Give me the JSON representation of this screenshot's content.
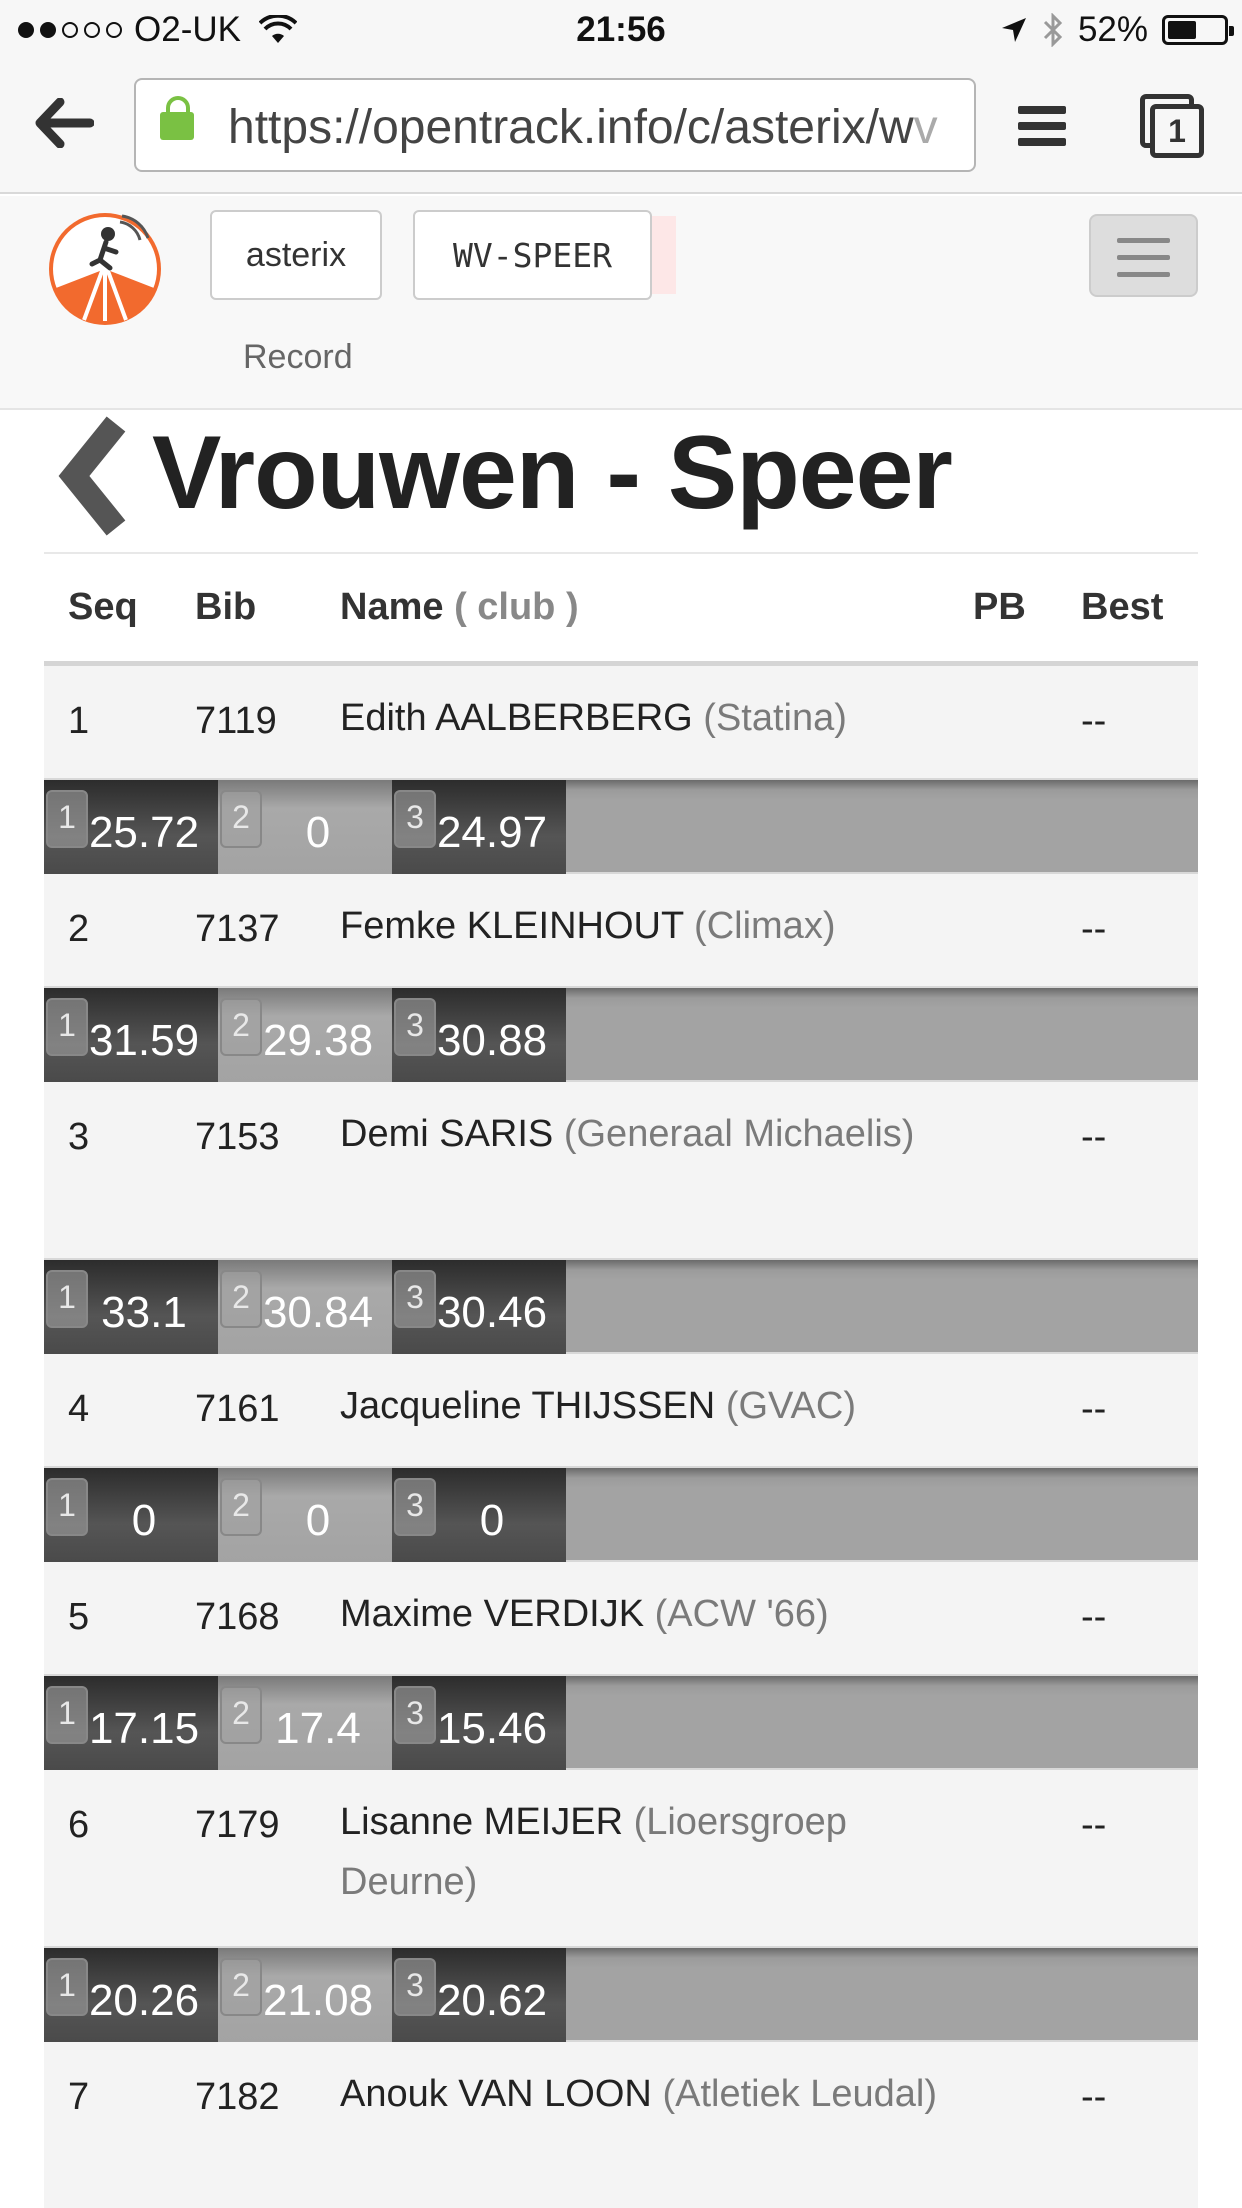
{
  "status_bar": {
    "carrier": "O2-UK",
    "time": "21:56",
    "battery": "52%",
    "signal_bars_filled": 2,
    "signal_bars_total": 5
  },
  "browser": {
    "url_main": "https://opentrack.info/c/asterix/w",
    "url_fade": "v",
    "tab_count": "1"
  },
  "header": {
    "competition_button": "asterix",
    "event_button": "WV-SPEER",
    "record_link": "Record"
  },
  "page_title": "Vrouwen - Speer",
  "table": {
    "columns": {
      "seq": "Seq",
      "bib": "Bib",
      "name": "Name",
      "club": "( club )",
      "pb": "PB",
      "best": "Best"
    },
    "rows": [
      {
        "seq": "1",
        "bib": "7119",
        "name": "Edith AALBERBERG",
        "club": "(Statina)",
        "pb": "",
        "best": "--",
        "attempts": [
          {
            "n": "1",
            "v": "25.72"
          },
          {
            "n": "2",
            "v": "0"
          },
          {
            "n": "3",
            "v": "24.97"
          }
        ]
      },
      {
        "seq": "2",
        "bib": "7137",
        "name": "Femke KLEINHOUT",
        "club": "(Climax)",
        "pb": "",
        "best": "--",
        "attempts": [
          {
            "n": "1",
            "v": "31.59"
          },
          {
            "n": "2",
            "v": "29.38"
          },
          {
            "n": "3",
            "v": "30.88"
          }
        ]
      },
      {
        "seq": "3",
        "bib": "7153",
        "name": "Demi SARIS",
        "club": "(Generaal Michaelis)",
        "pb": "",
        "best": "--",
        "attempts": [
          {
            "n": "1",
            "v": "33.1"
          },
          {
            "n": "2",
            "v": "30.84"
          },
          {
            "n": "3",
            "v": "30.46"
          }
        ]
      },
      {
        "seq": "4",
        "bib": "7161",
        "name": "Jacqueline THIJSSEN",
        "club": "(GVAC)",
        "pb": "",
        "best": "--",
        "attempts": [
          {
            "n": "1",
            "v": "0"
          },
          {
            "n": "2",
            "v": "0"
          },
          {
            "n": "3",
            "v": "0"
          }
        ]
      },
      {
        "seq": "5",
        "bib": "7168",
        "name": "Maxime VERDIJK",
        "club": "(ACW '66)",
        "pb": "",
        "best": "--",
        "attempts": [
          {
            "n": "1",
            "v": "17.15"
          },
          {
            "n": "2",
            "v": "17.4"
          },
          {
            "n": "3",
            "v": "15.46"
          }
        ]
      },
      {
        "seq": "6",
        "bib": "7179",
        "name": "Lisanne MEIJER",
        "club": "(Lioersgroep Deurne)",
        "pb": "",
        "best": "--",
        "attempts": [
          {
            "n": "1",
            "v": "20.26"
          },
          {
            "n": "2",
            "v": "21.08"
          },
          {
            "n": "3",
            "v": "20.62"
          }
        ]
      },
      {
        "seq": "7",
        "bib": "7182",
        "name": "Anouk VAN LOON",
        "club": "(Atletiek Leudal)",
        "pb": "",
        "best": "--",
        "attempts": []
      }
    ]
  },
  "colors": {
    "brand_orange": "#f26a2e",
    "attempt_dark": "#4a4a4a",
    "attempt_light": "#a3a3a3"
  },
  "icons": [
    "wifi-icon",
    "location-arrow-icon",
    "bluetooth-icon",
    "battery-icon",
    "back-arrow-icon",
    "lock-icon",
    "menu-icon",
    "tabs-icon",
    "opentrack-logo",
    "hamburger-icon",
    "chevron-left-icon"
  ]
}
